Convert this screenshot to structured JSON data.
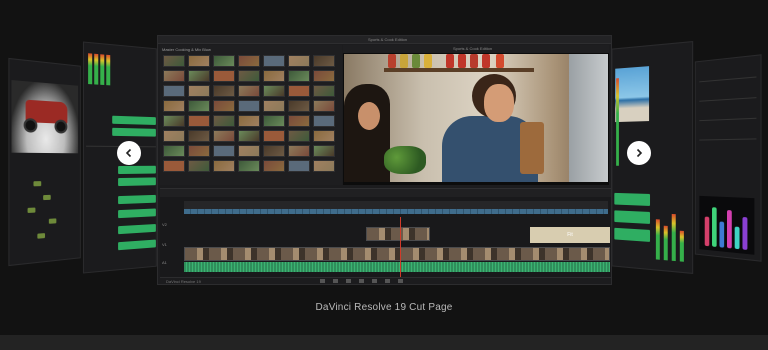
{
  "app": {
    "project_title": "Sports & Cook Edition",
    "media_pool_label": "Master  Cooking & Mix  Bluw",
    "viewer_title": "Sports & Cook Edition",
    "footer_brand": "DaVinci Resolve 19",
    "timecode": "00:00:23:00"
  },
  "timeline": {
    "title_clip_label": "Fit"
  },
  "carousel": {
    "prev_icon": "chevron-left-icon",
    "next_icon": "chevron-right-icon"
  },
  "caption": "DaVinci Resolve 19 Cut Page",
  "colors": {
    "background": "#121212",
    "audio_green": "#2fae62",
    "playhead_red": "#d13b2a",
    "button_white": "#ffffff"
  }
}
